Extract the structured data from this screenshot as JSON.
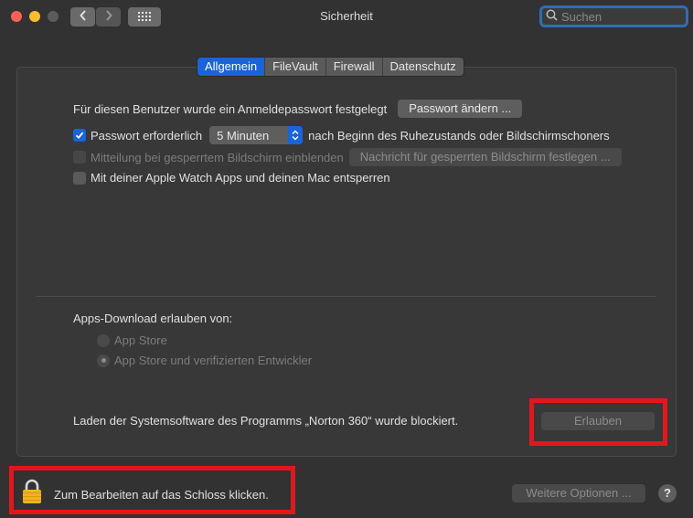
{
  "window": {
    "title": "Sicherheit"
  },
  "toolbar": {
    "back_icon": "chevron-left-icon",
    "forward_icon": "chevron-right-icon",
    "grid_icon": "grid-icon"
  },
  "search": {
    "placeholder": "Suchen",
    "value": ""
  },
  "tabs": [
    {
      "label": "Allgemein",
      "active": true
    },
    {
      "label": "FileVault",
      "active": false
    },
    {
      "label": "Firewall",
      "active": false
    },
    {
      "label": "Datenschutz",
      "active": false
    }
  ],
  "general": {
    "password_set_text": "Für diesen Benutzer wurde ein Anmeldepasswort festgelegt",
    "change_password_button": "Passwort ändern ...",
    "require_password_label": "Passwort erforderlich",
    "require_password_checked": true,
    "require_password_delay": "5 Minuten",
    "require_password_suffix": "nach Beginn des Ruhezustands oder Bildschirmschoners",
    "lock_message_label": "Mitteilung bei gesperrtem Bildschirm einblenden",
    "lock_message_button": "Nachricht für gesperrten Bildschirm festlegen ...",
    "apple_watch_label": "Mit deiner Apple Watch Apps und deinen Mac entsperren"
  },
  "downloads": {
    "heading": "Apps-Download erlauben von:",
    "options": [
      {
        "label": "App Store",
        "selected": false
      },
      {
        "label": "App Store und verifizierten Entwickler",
        "selected": true
      }
    ]
  },
  "blocked": {
    "message": "Laden der Systemsoftware des Programms „Norton 360“ wurde blockiert.",
    "allow_button": "Erlauben"
  },
  "footer": {
    "lock_text": "Zum Bearbeiten auf das Schloss klicken.",
    "more_options_button": "Weitere Optionen ...",
    "help_label": "?"
  },
  "colors": {
    "accent": "#1a63d9",
    "highlight": "#e0181d",
    "background": "#323232"
  }
}
